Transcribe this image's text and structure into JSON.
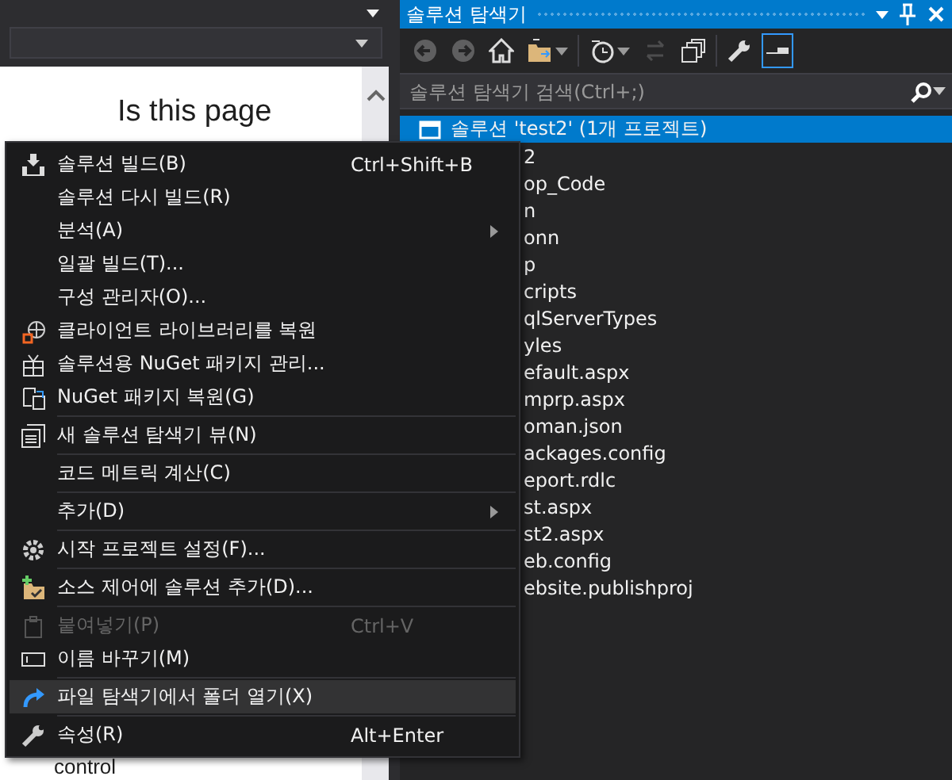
{
  "left_pane": {
    "heading": "Is this page",
    "footer": "control"
  },
  "solution_explorer": {
    "title": "솔루션 탐색기",
    "toolbar": [
      {
        "kind": "back",
        "disabled": true,
        "selected": false
      },
      {
        "kind": "forward",
        "disabled": true,
        "selected": false
      },
      {
        "kind": "home",
        "disabled": false,
        "selected": false
      },
      {
        "kind": "folder-sync",
        "disabled": false,
        "selected": false
      },
      {
        "kind": "history",
        "disabled": false,
        "selected": false
      },
      {
        "kind": "sync",
        "disabled": true,
        "selected": false
      },
      {
        "kind": "collapse",
        "disabled": false,
        "selected": false
      },
      {
        "kind": "properties",
        "disabled": false,
        "selected": false
      },
      {
        "kind": "preview",
        "disabled": false,
        "selected": true
      }
    ],
    "search": {
      "placeholder": "솔루션 탐색기 검색(Ctrl+;)"
    },
    "tree": [
      {
        "label": "솔루션 'test2' (1개 프로젝트)",
        "selected": true
      },
      {
        "label": "2",
        "selected": false
      },
      {
        "label": "op_Code",
        "selected": false
      },
      {
        "label": "n",
        "selected": false
      },
      {
        "label": "onn",
        "selected": false
      },
      {
        "label": "p",
        "selected": false
      },
      {
        "label": "cripts",
        "selected": false
      },
      {
        "label": "qlServerTypes",
        "selected": false
      },
      {
        "label": "yles",
        "selected": false
      },
      {
        "label": "efault.aspx",
        "selected": false
      },
      {
        "label": "mprp.aspx",
        "selected": false
      },
      {
        "label": "oman.json",
        "selected": false
      },
      {
        "label": "ackages.config",
        "selected": false
      },
      {
        "label": "eport.rdlc",
        "selected": false
      },
      {
        "label": "st.aspx",
        "selected": false
      },
      {
        "label": "st2.aspx",
        "selected": false
      },
      {
        "label": "eb.config",
        "selected": false
      },
      {
        "label": "ebsite.publishproj",
        "selected": false
      }
    ]
  },
  "context_menu": {
    "groups": [
      [
        {
          "label": "솔루션 빌드(B)",
          "shortcut": "Ctrl+Shift+B",
          "kind": "build",
          "disabled": false,
          "selected": false
        },
        {
          "label": "솔루션 다시 빌드(R)",
          "disabled": false,
          "selected": false
        },
        {
          "label": "분석(A)",
          "submenu": true,
          "disabled": false,
          "selected": false
        },
        {
          "label": "일괄 빌드(T)...",
          "disabled": false,
          "selected": false
        },
        {
          "label": "구성 관리자(O)...",
          "disabled": false,
          "selected": false
        },
        {
          "label": "클라이언트 라이브러리를 복원",
          "kind": "globe",
          "disabled": false,
          "selected": false
        },
        {
          "label": "솔루션용 NuGet 패키지 관리...",
          "kind": "package",
          "disabled": false,
          "selected": false
        },
        {
          "label": "NuGet 패키지 복원(G)",
          "kind": "restore",
          "disabled": false,
          "selected": false
        }
      ],
      [
        {
          "label": "새 솔루션 탐색기 뷰(N)",
          "kind": "window",
          "disabled": false,
          "selected": false
        }
      ],
      [
        {
          "label": "코드 메트릭 계산(C)",
          "disabled": false,
          "selected": false
        }
      ],
      [
        {
          "label": "추가(D)",
          "submenu": true,
          "disabled": false,
          "selected": false
        }
      ],
      [
        {
          "label": "시작 프로젝트 설정(F)...",
          "kind": "gear",
          "disabled": false,
          "selected": false
        }
      ],
      [
        {
          "label": "소스 제어에 솔루션 추가(D)...",
          "kind": "source",
          "disabled": false,
          "selected": false
        }
      ],
      [
        {
          "label": "붙여넣기(P)",
          "shortcut": "Ctrl+V",
          "kind": "paste",
          "disabled": true,
          "selected": false
        },
        {
          "label": "이름 바꾸기(M)",
          "kind": "rename",
          "disabled": false,
          "selected": false
        }
      ],
      [
        {
          "label": "파일 탐색기에서 폴더 열기(X)",
          "kind": "redo",
          "disabled": false,
          "selected": true
        }
      ],
      [
        {
          "label": "속성(R)",
          "shortcut": "Alt+Enter",
          "kind": "wrench",
          "disabled": false,
          "selected": false
        }
      ]
    ]
  }
}
